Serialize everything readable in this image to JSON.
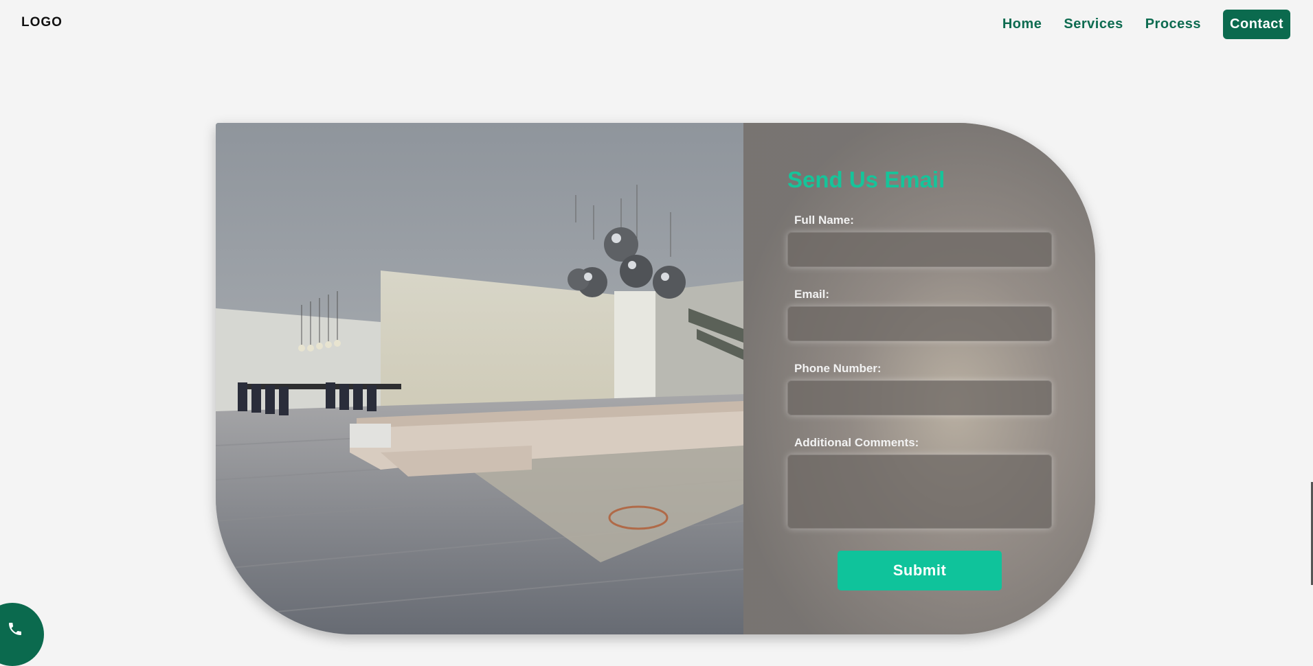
{
  "header": {
    "logo": "LOGO",
    "nav": [
      {
        "label": "Home"
      },
      {
        "label": "Services"
      },
      {
        "label": "Process"
      },
      {
        "label": "Contact",
        "active": true
      }
    ]
  },
  "photo": {
    "subject": "modern interior living room with sectional sofa, pendant lights and dining area"
  },
  "form": {
    "title": "Send Us Email",
    "fields": [
      {
        "label": "Full Name:",
        "value": "",
        "placeholder": ""
      },
      {
        "label": "Email:",
        "value": "",
        "placeholder": ""
      },
      {
        "label": "Phone Number:",
        "value": "",
        "placeholder": ""
      },
      {
        "label": "Additional Comments:",
        "value": "",
        "placeholder": ""
      }
    ],
    "submit_label": "Submit"
  },
  "fab": {
    "icon": "phone-icon"
  },
  "colors": {
    "brand": "#0b6a4e",
    "accent": "#16c49a",
    "background": "#f4f4f4"
  }
}
